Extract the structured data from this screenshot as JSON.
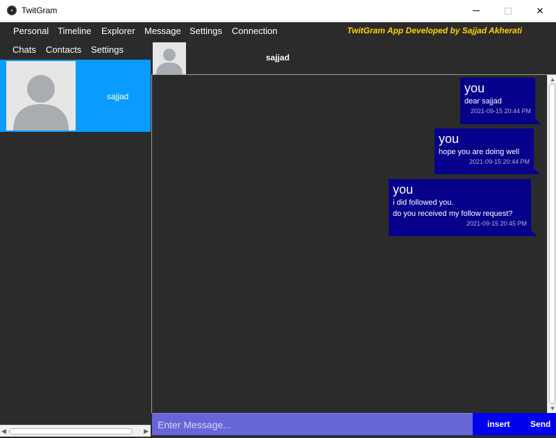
{
  "window": {
    "title": "TwitGram",
    "minimize_icon": "minimize-icon",
    "maximize_icon": "maximize-icon",
    "close_glyph": "✕"
  },
  "menu": {
    "items": [
      {
        "label": "Personal"
      },
      {
        "label": "Timeline"
      },
      {
        "label": "Explorer"
      },
      {
        "label": "Message"
      },
      {
        "label": "Settings"
      },
      {
        "label": "Connection"
      }
    ],
    "brand": "TwitGram App Developed by Sajjad Akherati",
    "brand_color": "#ffd200"
  },
  "sidebar": {
    "tabs": [
      {
        "label": "Chats"
      },
      {
        "label": "Contacts"
      },
      {
        "label": "Settings"
      }
    ],
    "contacts": [
      {
        "name": "sajjad",
        "selected": true
      }
    ],
    "selected_color": "#0a9bff"
  },
  "chat": {
    "header_name": "sajjad",
    "messages": [
      {
        "sender": "you",
        "text": "dear sajjad",
        "time": "2021-09-15 20:44 PM"
      },
      {
        "sender": "you",
        "text": "hope you are doing well",
        "time": "2021-09-15 20:44 PM"
      },
      {
        "sender": "you",
        "text": "i did followed you.\ndo you received my follow request?",
        "time": "2021-09-15 20:45 PM"
      }
    ],
    "bubble_color": "#06008a"
  },
  "composer": {
    "placeholder": "Enter Message...",
    "value": "",
    "insert_label": "insert",
    "send_label": "Send",
    "input_color": "#6865d8",
    "button_color": "#0000f0"
  }
}
